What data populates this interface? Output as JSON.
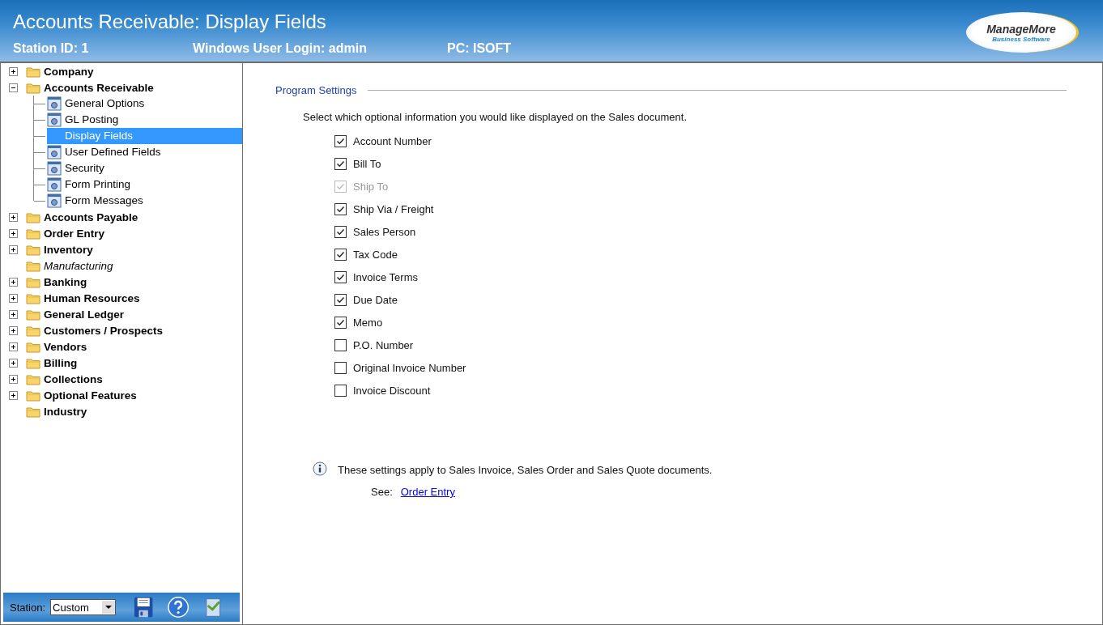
{
  "header": {
    "title": "Accounts Receivable: Display Fields",
    "station_id": "Station ID: 1",
    "login": "Windows User Login: admin",
    "pc": "PC: ISOFT",
    "logo": {
      "name": "ManageMore",
      "tagline": "Business Software"
    }
  },
  "tree": [
    {
      "label": "Company",
      "expandable": true,
      "expanded": false,
      "available": true
    },
    {
      "label": "Accounts Receivable",
      "expandable": true,
      "expanded": true,
      "available": true,
      "children": [
        {
          "label": "General Options",
          "selected": false
        },
        {
          "label": "GL Posting",
          "selected": false
        },
        {
          "label": "Display Fields",
          "selected": true
        },
        {
          "label": "User Defined Fields",
          "selected": false
        },
        {
          "label": "Security",
          "selected": false
        },
        {
          "label": "Form Printing",
          "selected": false
        },
        {
          "label": "Form Messages",
          "selected": false
        }
      ]
    },
    {
      "label": "Accounts Payable",
      "expandable": true,
      "expanded": false,
      "available": true
    },
    {
      "label": "Order Entry",
      "expandable": true,
      "expanded": false,
      "available": true
    },
    {
      "label": "Inventory",
      "expandable": true,
      "expanded": false,
      "available": true
    },
    {
      "label": "Manufacturing",
      "expandable": false,
      "available": false
    },
    {
      "label": "Banking",
      "expandable": true,
      "expanded": false,
      "available": true
    },
    {
      "label": "Human Resources",
      "expandable": true,
      "expanded": false,
      "available": true
    },
    {
      "label": "General Ledger",
      "expandable": true,
      "expanded": false,
      "available": true
    },
    {
      "label": "Customers / Prospects",
      "expandable": true,
      "expanded": false,
      "available": true
    },
    {
      "label": "Vendors",
      "expandable": true,
      "expanded": false,
      "available": true
    },
    {
      "label": "Billing",
      "expandable": true,
      "expanded": false,
      "available": true
    },
    {
      "label": "Collections",
      "expandable": true,
      "expanded": false,
      "available": true
    },
    {
      "label": "Optional Features",
      "expandable": true,
      "expanded": false,
      "available": true
    },
    {
      "label": "Industry",
      "expandable": false,
      "available": true
    }
  ],
  "station_bar": {
    "label": "Station:",
    "value": "Custom"
  },
  "settings": {
    "group_title": "Program Settings",
    "prompt": "Select which optional information you would like displayed on the Sales document.",
    "fields": [
      {
        "label": "Account Number",
        "checked": true,
        "disabled": false
      },
      {
        "label": "Bill To",
        "checked": true,
        "disabled": false
      },
      {
        "label": "Ship To",
        "checked": true,
        "disabled": true
      },
      {
        "label": "Ship Via / Freight",
        "checked": true,
        "disabled": false
      },
      {
        "label": "Sales Person",
        "checked": true,
        "disabled": false
      },
      {
        "label": "Tax Code",
        "checked": true,
        "disabled": false
      },
      {
        "label": "Invoice Terms",
        "checked": true,
        "disabled": false
      },
      {
        "label": "Due Date",
        "checked": true,
        "disabled": false
      },
      {
        "label": "Memo",
        "checked": true,
        "disabled": false
      },
      {
        "label": "P.O. Number",
        "checked": false,
        "disabled": false
      },
      {
        "label": "Original Invoice Number",
        "checked": false,
        "disabled": false
      },
      {
        "label": "Invoice Discount",
        "checked": false,
        "disabled": false
      }
    ],
    "note": "These settings apply to Sales Invoice, Sales Order and Sales Quote documents.",
    "see_label": "See:",
    "see_link": "Order Entry"
  }
}
